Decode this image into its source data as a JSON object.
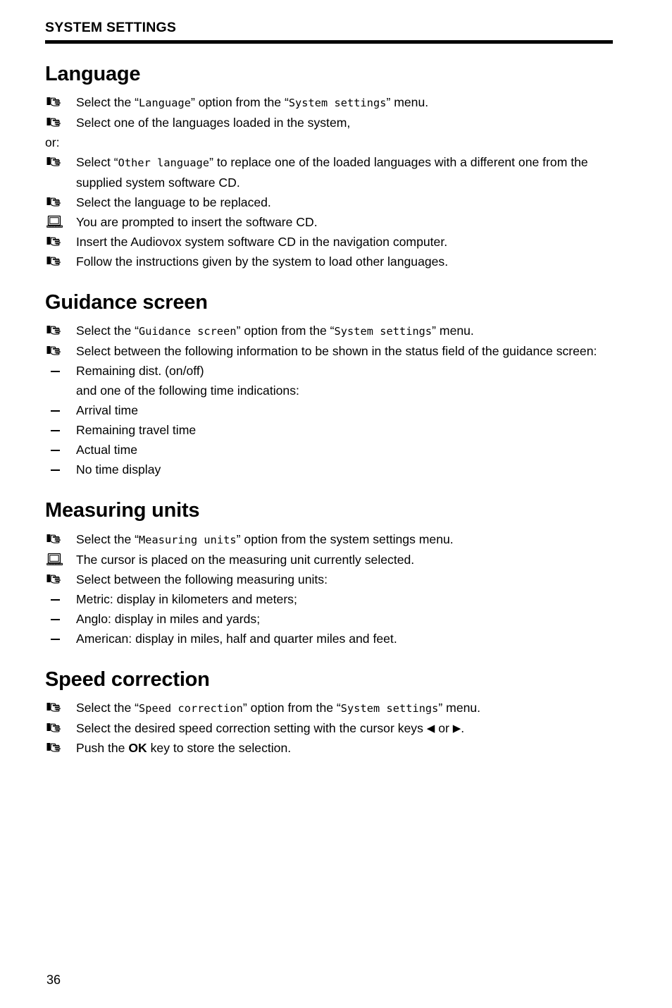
{
  "document": {
    "running_head": "SYSTEM SETTINGS",
    "page_number": "36"
  },
  "sections": [
    {
      "id": "language",
      "title": "Language",
      "items": [
        {
          "marker": "hand-pointing-icon",
          "parts": [
            {
              "t": "plain",
              "v": "Select the “"
            },
            {
              "t": "ui",
              "v": "Language"
            },
            {
              "t": "plain",
              "v": "” option from the “"
            },
            {
              "t": "ui",
              "v": "System settings"
            },
            {
              "t": "plain",
              "v": "” menu."
            }
          ]
        },
        {
          "marker": "hand-pointing-icon",
          "parts": [
            {
              "t": "plain",
              "v": "Select one of the languages loaded in the system,"
            }
          ]
        },
        {
          "marker": "none",
          "parts": [
            {
              "t": "plain",
              "v": "or:"
            }
          ]
        },
        {
          "marker": "hand-pointing-icon",
          "parts": [
            {
              "t": "plain",
              "v": "Select “"
            },
            {
              "t": "ui",
              "v": "Other language"
            },
            {
              "t": "plain",
              "v": "” to replace one of the loaded languages with a different one from the supplied system software CD."
            }
          ]
        },
        {
          "marker": "hand-pointing-icon",
          "parts": [
            {
              "t": "plain",
              "v": "Select the language to be replaced."
            }
          ]
        },
        {
          "marker": "laptop-icon",
          "parts": [
            {
              "t": "plain",
              "v": "You are prompted to insert the software CD."
            }
          ]
        },
        {
          "marker": "hand-pointing-icon",
          "parts": [
            {
              "t": "plain",
              "v": "Insert the Audiovox system software CD in the navigation computer."
            }
          ]
        },
        {
          "marker": "hand-pointing-icon",
          "parts": [
            {
              "t": "plain",
              "v": "Follow the instructions given by the system to load other languages."
            }
          ]
        }
      ]
    },
    {
      "id": "guidance-screen",
      "title": "Guidance screen",
      "items": [
        {
          "marker": "hand-pointing-icon",
          "parts": [
            {
              "t": "plain",
              "v": "Select the “"
            },
            {
              "t": "ui",
              "v": "Guidance screen"
            },
            {
              "t": "plain",
              "v": "” option from the “"
            },
            {
              "t": "ui",
              "v": "System settings"
            },
            {
              "t": "plain",
              "v": "” menu."
            }
          ]
        },
        {
          "marker": "hand-pointing-icon",
          "parts": [
            {
              "t": "plain",
              "v": "Select between the following information to be shown in the status field of the guidance screen:"
            }
          ]
        },
        {
          "marker": "dash",
          "parts": [
            {
              "t": "plain",
              "v": "Remaining dist. (on/off)"
            }
          ]
        },
        {
          "marker": "none-indent",
          "parts": [
            {
              "t": "plain",
              "v": "and one of the following time indications:"
            }
          ]
        },
        {
          "marker": "dash",
          "parts": [
            {
              "t": "plain",
              "v": "Arrival time"
            }
          ]
        },
        {
          "marker": "dash",
          "parts": [
            {
              "t": "plain",
              "v": "Remaining travel time"
            }
          ]
        },
        {
          "marker": "dash",
          "parts": [
            {
              "t": "plain",
              "v": "Actual time"
            }
          ]
        },
        {
          "marker": "dash",
          "parts": [
            {
              "t": "plain",
              "v": "No time display"
            }
          ]
        }
      ]
    },
    {
      "id": "measuring-units",
      "title": "Measuring units",
      "items": [
        {
          "marker": "hand-pointing-icon",
          "parts": [
            {
              "t": "plain",
              "v": "Select the “"
            },
            {
              "t": "ui",
              "v": "Measuring units"
            },
            {
              "t": "plain",
              "v": "” option from the system settings menu."
            }
          ]
        },
        {
          "marker": "laptop-icon",
          "parts": [
            {
              "t": "plain",
              "v": "The cursor is placed on the measuring unit currently selected."
            }
          ]
        },
        {
          "marker": "hand-pointing-icon",
          "parts": [
            {
              "t": "plain",
              "v": "Select between the following measuring units:"
            }
          ]
        },
        {
          "marker": "dash",
          "parts": [
            {
              "t": "plain",
              "v": "Metric: display in kilometers and meters;"
            }
          ]
        },
        {
          "marker": "dash",
          "parts": [
            {
              "t": "plain",
              "v": "Anglo: display in miles and yards;"
            }
          ]
        },
        {
          "marker": "dash",
          "parts": [
            {
              "t": "plain",
              "v": "American: display in miles, half and quarter miles and feet."
            }
          ]
        }
      ]
    },
    {
      "id": "speed-correction",
      "title": "Speed correction",
      "items": [
        {
          "marker": "hand-pointing-icon",
          "parts": [
            {
              "t": "plain",
              "v": "Select the “"
            },
            {
              "t": "ui",
              "v": "Speed correction"
            },
            {
              "t": "plain",
              "v": "” option from the “"
            },
            {
              "t": "ui",
              "v": "System settings"
            },
            {
              "t": "plain",
              "v": "” menu."
            }
          ]
        },
        {
          "marker": "hand-pointing-icon",
          "parts": [
            {
              "t": "plain",
              "v": "Select the desired speed correction setting with the cursor keys "
            },
            {
              "t": "arrow",
              "v": "◀"
            },
            {
              "t": "plain",
              "v": " or "
            },
            {
              "t": "arrow",
              "v": "▶"
            },
            {
              "t": "plain",
              "v": "."
            }
          ]
        },
        {
          "marker": "hand-pointing-icon",
          "parts": [
            {
              "t": "plain",
              "v": "Push the "
            },
            {
              "t": "bold",
              "v": "OK"
            },
            {
              "t": "plain",
              "v": " key to store the selection."
            }
          ]
        }
      ]
    }
  ]
}
